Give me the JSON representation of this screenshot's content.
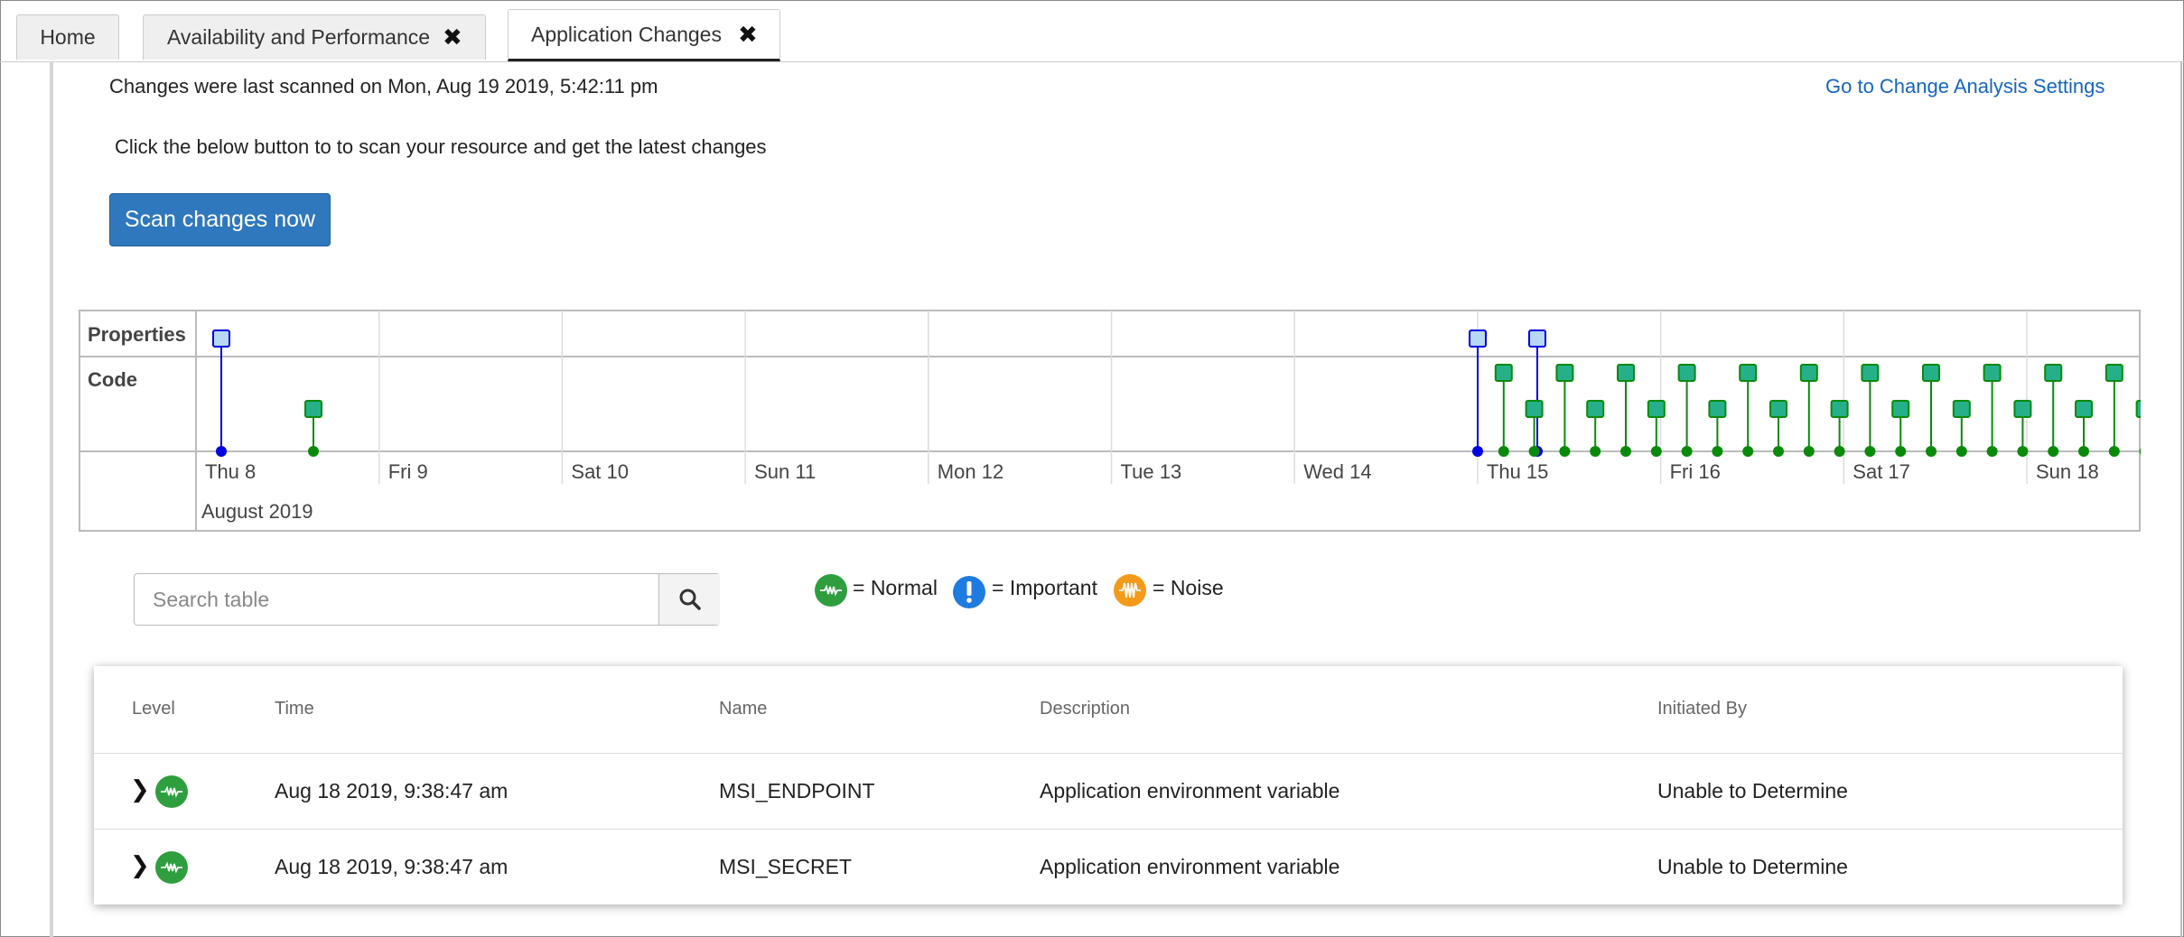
{
  "tabs": [
    {
      "label": "Home",
      "closable": false,
      "active": false
    },
    {
      "label": "Availability and Performance",
      "closable": true,
      "active": false
    },
    {
      "label": "Application Changes",
      "closable": true,
      "active": true
    }
  ],
  "close_glyph": "✖",
  "scan_info": "Changes were last scanned on Mon, Aug 19 2019, 5:42:11 pm",
  "settings_link": "Go to Change Analysis Settings",
  "instruction": "Click the below button to to scan your resource and get the latest changes",
  "scan_button": "Scan changes now",
  "timeline": {
    "rows": [
      "Properties",
      "Code"
    ],
    "days": [
      "Thu 8",
      "Fri 9",
      "Sat 10",
      "Sun 11",
      "Mon 12",
      "Tue 13",
      "Wed 14",
      "Thu 15",
      "Fri 16",
      "Sat 17",
      "Sun 18"
    ],
    "month": "August 2019",
    "colors": {
      "property": "#0000e0",
      "property_fill": "#b7d7f5",
      "code": "#0a8a0a",
      "code_fill": "#26b08a"
    }
  },
  "search": {
    "placeholder": "Search table",
    "icon": "search-icon"
  },
  "legend": [
    {
      "label": "= Normal",
      "icon": "normal-level-icon",
      "color": "#2e9e3e"
    },
    {
      "label": "= Important",
      "icon": "important-level-icon",
      "color": "#1e7be0"
    },
    {
      "label": "= Noise",
      "icon": "noise-level-icon",
      "color": "#f39a1b"
    }
  ],
  "table": {
    "headers": [
      "Level",
      "Time",
      "Name",
      "Description",
      "Initiated By"
    ],
    "rows": [
      {
        "level": "Normal",
        "time": "Aug 18 2019, 9:38:47 am",
        "name": "MSI_ENDPOINT",
        "description": "Application environment variable",
        "initiated_by": "Unable to Determine"
      },
      {
        "level": "Normal",
        "time": "Aug 18 2019, 9:38:47 am",
        "name": "MSI_SECRET",
        "description": "Application environment variable",
        "initiated_by": "Unable to Determine"
      }
    ]
  }
}
